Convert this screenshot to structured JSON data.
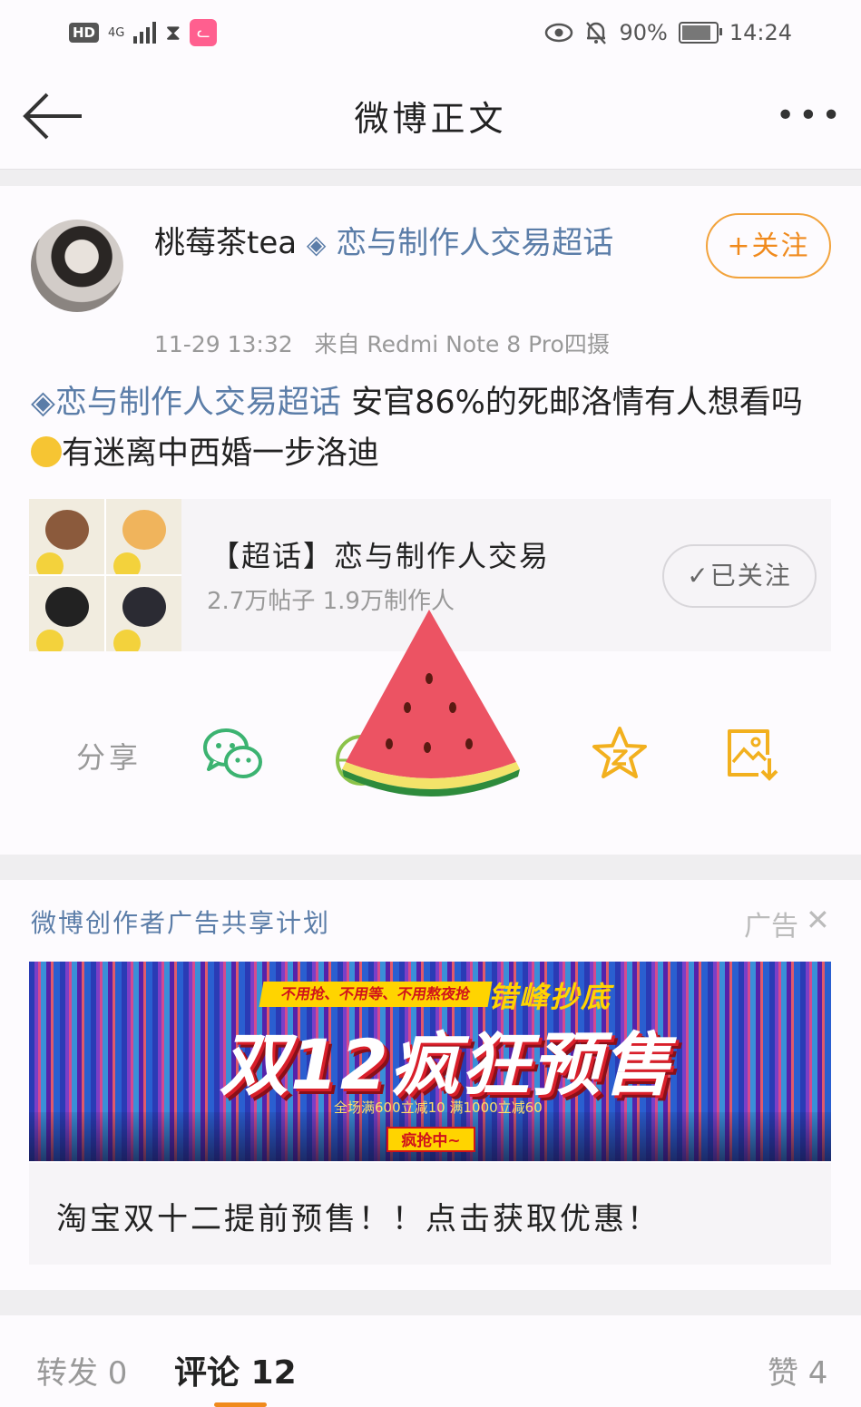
{
  "status_bar": {
    "hd": "HD",
    "network": "4G",
    "battery_text": "90%",
    "battery_level": 0.9,
    "time": "14:24"
  },
  "nav": {
    "title": "微博正文",
    "more": "•••"
  },
  "post": {
    "author_name": "桃莓茶tea",
    "author_topic": "恋与制作人交易超话",
    "follow_label": "+关注",
    "timestamp": "11-29 13:32",
    "source": "来自 Redmi Note 8 Pro四摄",
    "topic_link": "恋与制作人交易超话",
    "text_main": " 安官86%的死邮洛情有人想看吗",
    "text_tail": "有迷离中西婚一步洛迪"
  },
  "topic_card": {
    "name": "【超话】恋与制作人交易",
    "stats": "2.7万帖子 1.9万制作人",
    "followed_label": "✓已关注"
  },
  "share": {
    "label": "分享"
  },
  "ad": {
    "label": "微博创作者广告共享计划",
    "tag": "广告",
    "close": "✕",
    "banner_top_left": "不用抢、不用等、不用熬夜抢",
    "banner_top_right": "错峰抄底",
    "banner_main": "双12疯狂预售",
    "banner_sub": "全场满600立减10  满1000立减60",
    "banner_cta": "疯抢中~",
    "caption": "淘宝双十二提前预售！！点击获取优惠！"
  },
  "tabs": {
    "repost": "转发 0",
    "comment": "评论 12",
    "like": "赞 4"
  },
  "colors": {
    "accent_orange": "#f08a1c",
    "link_blue": "#5b7da8",
    "wechat_green": "#3cb371",
    "star_yellow": "#f2b01e"
  }
}
